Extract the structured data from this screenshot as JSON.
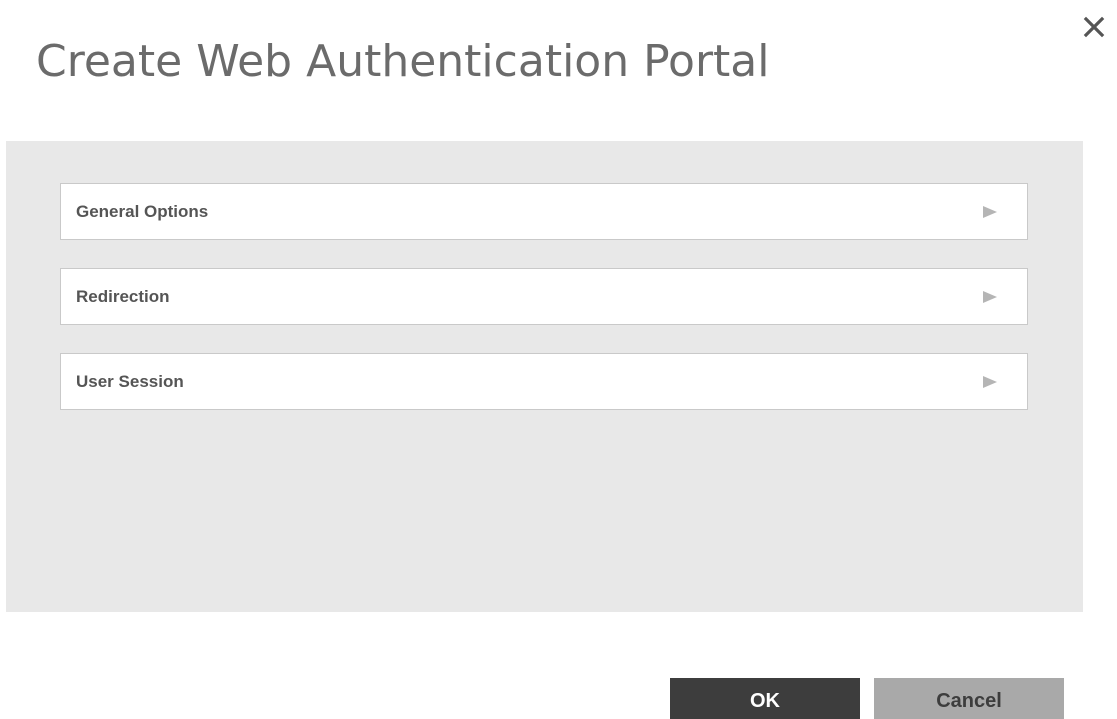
{
  "dialog": {
    "title": "Create Web Authentication Portal",
    "close_icon": "close-icon",
    "sections": [
      {
        "label": "General Options",
        "icon": "expand-arrow-icon"
      },
      {
        "label": "Redirection",
        "icon": "expand-arrow-icon"
      },
      {
        "label": "User Session",
        "icon": "expand-arrow-icon"
      }
    ],
    "buttons": {
      "ok_label": "OK",
      "cancel_label": "Cancel"
    }
  },
  "colors": {
    "panel_bg": "#e8e8e8",
    "ok_bg": "#3d3d3d",
    "cancel_bg": "#a9a9a9",
    "title_text": "#6b6b6b"
  }
}
